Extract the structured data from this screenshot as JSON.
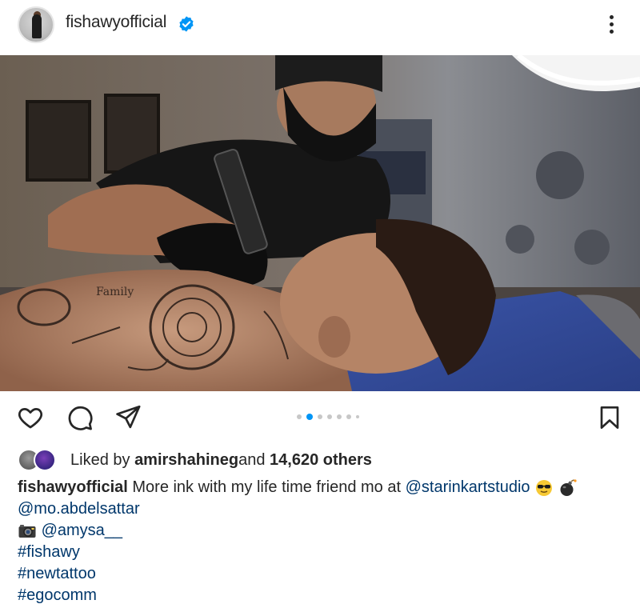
{
  "post": {
    "username": "fishawyofficial",
    "verified_icon": "verified-badge-icon",
    "more_icon": "more-vertical-icon",
    "carousel": {
      "count": 7,
      "active_index": 1
    }
  },
  "actions": {
    "like_icon": "heart-icon",
    "comment_icon": "comment-icon",
    "share_icon": "send-icon",
    "save_icon": "bookmark-icon"
  },
  "likes": {
    "prefix": "Liked by ",
    "user": "amirshahineg",
    "middle": " and ",
    "count": "14,620 others"
  },
  "caption": {
    "username": "fishawyofficial",
    "text": " More ink with my life time friend mo at ",
    "mention1": "@starinkartstudio",
    "mention2": "@mo.abdelsattar",
    "mention3": "@amysa__",
    "hashtags": [
      "#fishawy",
      "#newtattoo",
      "#egocomm"
    ]
  },
  "colors": {
    "link": "#00376b",
    "accent": "#0095f6",
    "text": "#262626"
  }
}
